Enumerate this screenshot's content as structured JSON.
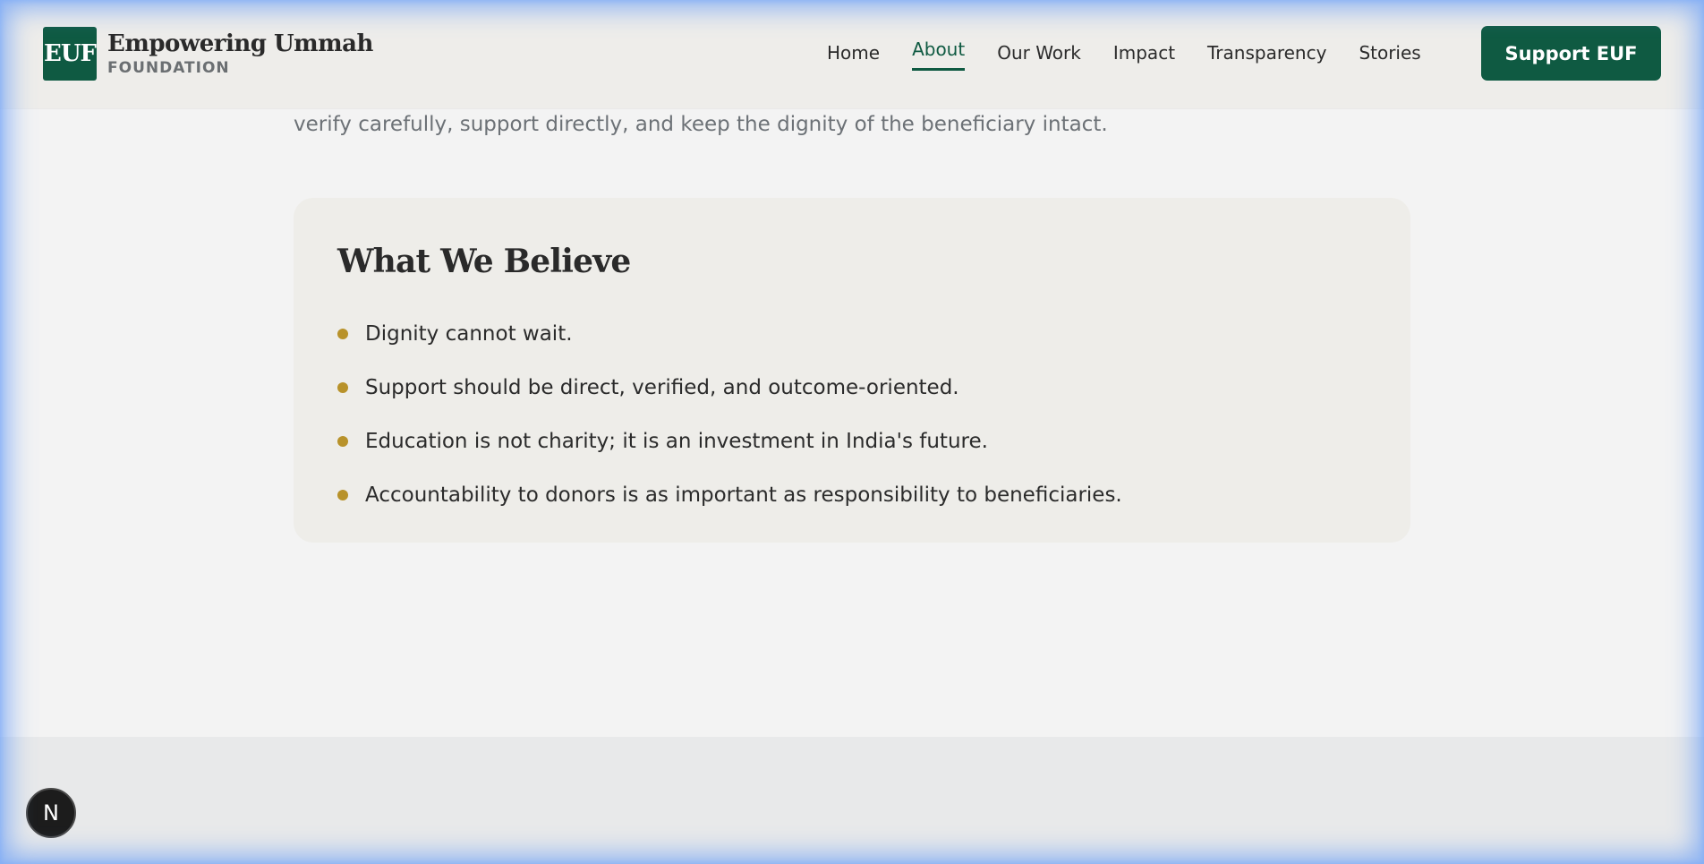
{
  "brand": {
    "mark": "EUF",
    "name": "Empowering Ummah",
    "sub": "FOUNDATION"
  },
  "nav": {
    "items": [
      {
        "label": "Home"
      },
      {
        "label": "About",
        "active": true
      },
      {
        "label": "Our Work"
      },
      {
        "label": "Impact"
      },
      {
        "label": "Transparency"
      },
      {
        "label": "Stories"
      }
    ],
    "cta_label": "Support EUF"
  },
  "main": {
    "intro_line": "verify carefully, support directly, and keep the dignity of the beneficiary intact.",
    "card": {
      "title": "What We Believe",
      "beliefs": [
        "Dignity cannot wait.",
        "Support should be direct, verified, and outcome-oriented.",
        "Education is not charity; it is an investment in India's future.",
        "Accountability to donors is as important as responsibility to beneficiaries."
      ]
    }
  },
  "dev_badge": {
    "label": "N"
  },
  "colors": {
    "brand_green": "#0f5a42",
    "bullet_gold": "#b8922a",
    "page_bg": "#f3f3f3",
    "card_bg": "#eeede9"
  }
}
